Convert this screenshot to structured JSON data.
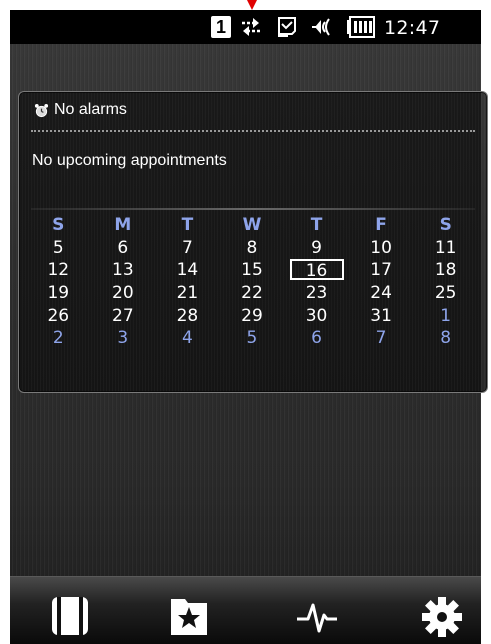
{
  "status_bar": {
    "sim_slot": "1",
    "time": "12:47",
    "icons": [
      "sync-icon",
      "message-icon",
      "volume-icon",
      "battery-icon"
    ]
  },
  "panel": {
    "alarm_text": "No alarms",
    "appointments_text": "No upcoming appointments"
  },
  "calendar": {
    "weekdays": [
      "S",
      "M",
      "T",
      "W",
      "T",
      "F",
      "S"
    ],
    "today": "16",
    "weeks": [
      [
        "5",
        "6",
        "7",
        "8",
        "9",
        "10",
        "11"
      ],
      [
        "12",
        "13",
        "14",
        "15",
        "16",
        "17",
        "18"
      ],
      [
        "19",
        "20",
        "21",
        "22",
        "23",
        "24",
        "25"
      ],
      [
        "26",
        "27",
        "28",
        "29",
        "30",
        "31",
        "1"
      ],
      [
        "2",
        "3",
        "4",
        "5",
        "6",
        "7",
        "8"
      ]
    ]
  },
  "toolbar": {
    "icons": [
      "cards-icon",
      "favorites-icon",
      "activity-icon",
      "settings-icon"
    ]
  },
  "colors": {
    "weekday_header": "#8ea4ea",
    "other_month": "#8ea4ea",
    "text": "#ffffff"
  }
}
